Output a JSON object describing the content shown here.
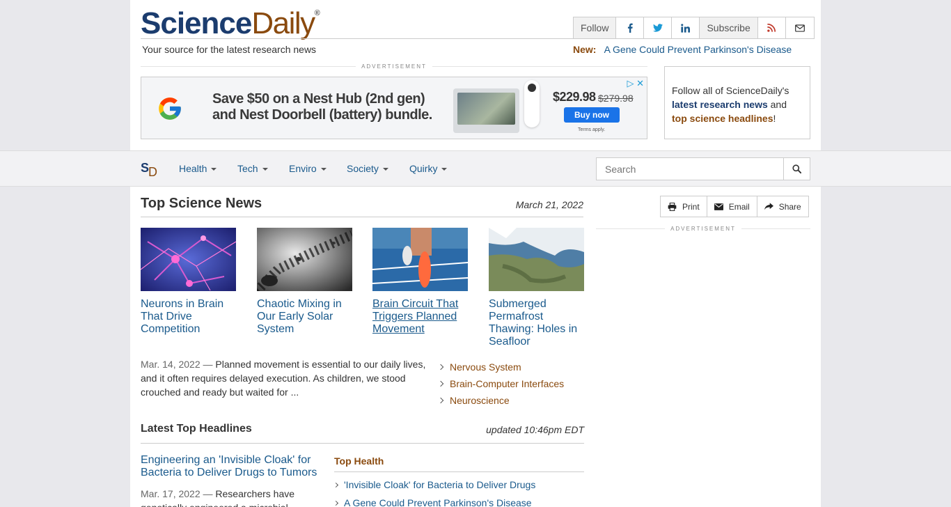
{
  "header": {
    "logo_science": "Science",
    "logo_daily": "Daily",
    "logo_reg": "®",
    "tagline": "Your source for the latest research news",
    "new_label": "New:",
    "new_link": "A Gene Could Prevent Parkinson's Disease"
  },
  "social": {
    "follow_label": "Follow",
    "subscribe_label": "Subscribe",
    "icons": [
      "facebook-icon",
      "twitter-icon",
      "linkedin-icon",
      "rss-icon",
      "email-icon"
    ]
  },
  "ads": {
    "label": "ADVERTISEMENT",
    "banner_headline_1": "Save $50 on a Nest Hub (2nd gen)",
    "banner_headline_2": "and Nest Doorbell (battery) bundle.",
    "price": "$229.98",
    "old_price": "$279.98",
    "buy_label": "Buy now",
    "terms": "Terms apply."
  },
  "followbox": {
    "text_1": "Follow all of ScienceDaily's",
    "link_1": "latest research news",
    "text_2": " and",
    "link_2": "top science headlines",
    "text_3": "!"
  },
  "nav": {
    "logo_s": "S",
    "logo_d": "D",
    "items": [
      "Health",
      "Tech",
      "Enviro",
      "Society",
      "Quirky"
    ],
    "search_placeholder": "Search"
  },
  "main": {
    "section_title": "Top Science News",
    "date": "March 21, 2022",
    "cards": [
      {
        "title": "Neurons in Brain That Drive Competition"
      },
      {
        "title": "Chaotic Mixing in Our Early Solar System"
      },
      {
        "title": "Brain Circuit That Triggers Planned Movement"
      },
      {
        "title": "Submerged Permafrost Thawing: Holes in Seafloor"
      }
    ],
    "summary_date": "Mar. 14, 2022",
    "summary_sep": " — ",
    "summary_text": "Planned movement is essential to our daily lives, and it often requires delayed execution. As children, we stood crouched and ready but waited for ...",
    "topics": [
      "Nervous System",
      "Brain-Computer Interfaces",
      "Neuroscience"
    ]
  },
  "latest": {
    "title": "Latest Top Headlines",
    "updated": "updated 10:46pm EDT",
    "story_title": "Engineering an 'Invisible Cloak' for Bacteria to Deliver Drugs to Tumors",
    "story_date": "Mar. 17, 2022",
    "story_sep": " — ",
    "story_text": "Researchers have genetically engineered a microbial",
    "top_health_label": "Top Health",
    "top_health": [
      "'Invisible Cloak' for Bacteria to Deliver Drugs",
      "A Gene Could Prevent Parkinson's Disease"
    ]
  },
  "actions": {
    "print": "Print",
    "email": "Email",
    "share": "Share"
  },
  "colors": {
    "brand_blue": "#1b3c6e",
    "brand_brown": "#8a4a0e",
    "link_blue": "#1a5a8c"
  }
}
